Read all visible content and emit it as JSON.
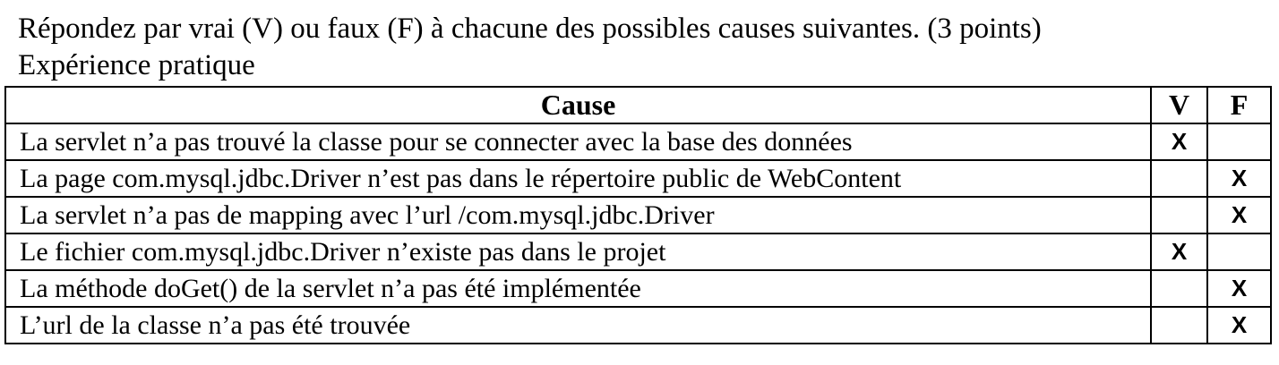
{
  "question": "Répondez par vrai (V) ou faux (F) à chacune des possibles causes suivantes. (3 points)",
  "subtitle": "Expérience pratique",
  "table": {
    "headers": {
      "cause": "Cause",
      "v": "V",
      "f": "F"
    },
    "rows": [
      {
        "cause": "La servlet n’a pas trouvé la classe pour se connecter avec la base des données",
        "v": "X",
        "f": ""
      },
      {
        "cause": "La page com.mysql.jdbc.Driver n’est pas dans le répertoire public de WebContent",
        "v": "",
        "f": "X"
      },
      {
        "cause": "La servlet n’a pas de mapping avec l’url /com.mysql.jdbc.Driver",
        "v": "",
        "f": "X"
      },
      {
        "cause": "Le fichier com.mysql.jdbc.Driver n’existe pas dans le projet",
        "v": "X",
        "f": ""
      },
      {
        "cause": "La méthode doGet() de la servlet n’a pas été implémentée",
        "v": "",
        "f": "X"
      },
      {
        "cause": "L’url de la classe n’a pas été trouvée",
        "v": "",
        "f": "X"
      }
    ]
  }
}
